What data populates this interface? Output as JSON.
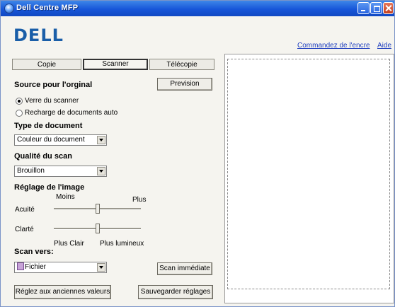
{
  "window": {
    "title": "Dell Centre MFP"
  },
  "brand": {
    "logo_text": "DELL"
  },
  "links": {
    "order_ink": "Commandez de l'encre",
    "help": "Aide"
  },
  "tabs": [
    {
      "label": "Copie",
      "active": false
    },
    {
      "label": "Scanner",
      "active": true
    },
    {
      "label": "Télécopie",
      "active": false
    }
  ],
  "source": {
    "heading": "Source pour l'orginal",
    "options": [
      {
        "label": "Verre du scanner",
        "selected": true
      },
      {
        "label": "Recharge de documents auto",
        "selected": false
      }
    ]
  },
  "preview_button": {
    "label": "Prevision"
  },
  "doc_type": {
    "heading": "Type de document",
    "value": "Couleur du document"
  },
  "scan_quality": {
    "heading": "Qualité du scan",
    "value": "Brouillon"
  },
  "image_adjust": {
    "heading": "Réglage de l'image",
    "less_label": "Moins",
    "more_label": "Plus",
    "sharpness_label": "Acuité",
    "sharpness_level": 0.5,
    "brightness_label": "Clarté",
    "brightness_level": 0.5,
    "lighter_label": "Plus Clair",
    "brighter_label": "Plus lumineux"
  },
  "scan_to": {
    "heading": "Scan vers:",
    "value": "Fichier",
    "icon": "file-icon"
  },
  "buttons": {
    "scan_now": "Scan immédiate",
    "reset": "Réglez aux anciennes valeurs",
    "save": "Sauvegarder réglages"
  },
  "colors": {
    "titlebar": "#1756d9",
    "link": "#1f3fbf",
    "brand": "#1a5ea8"
  }
}
